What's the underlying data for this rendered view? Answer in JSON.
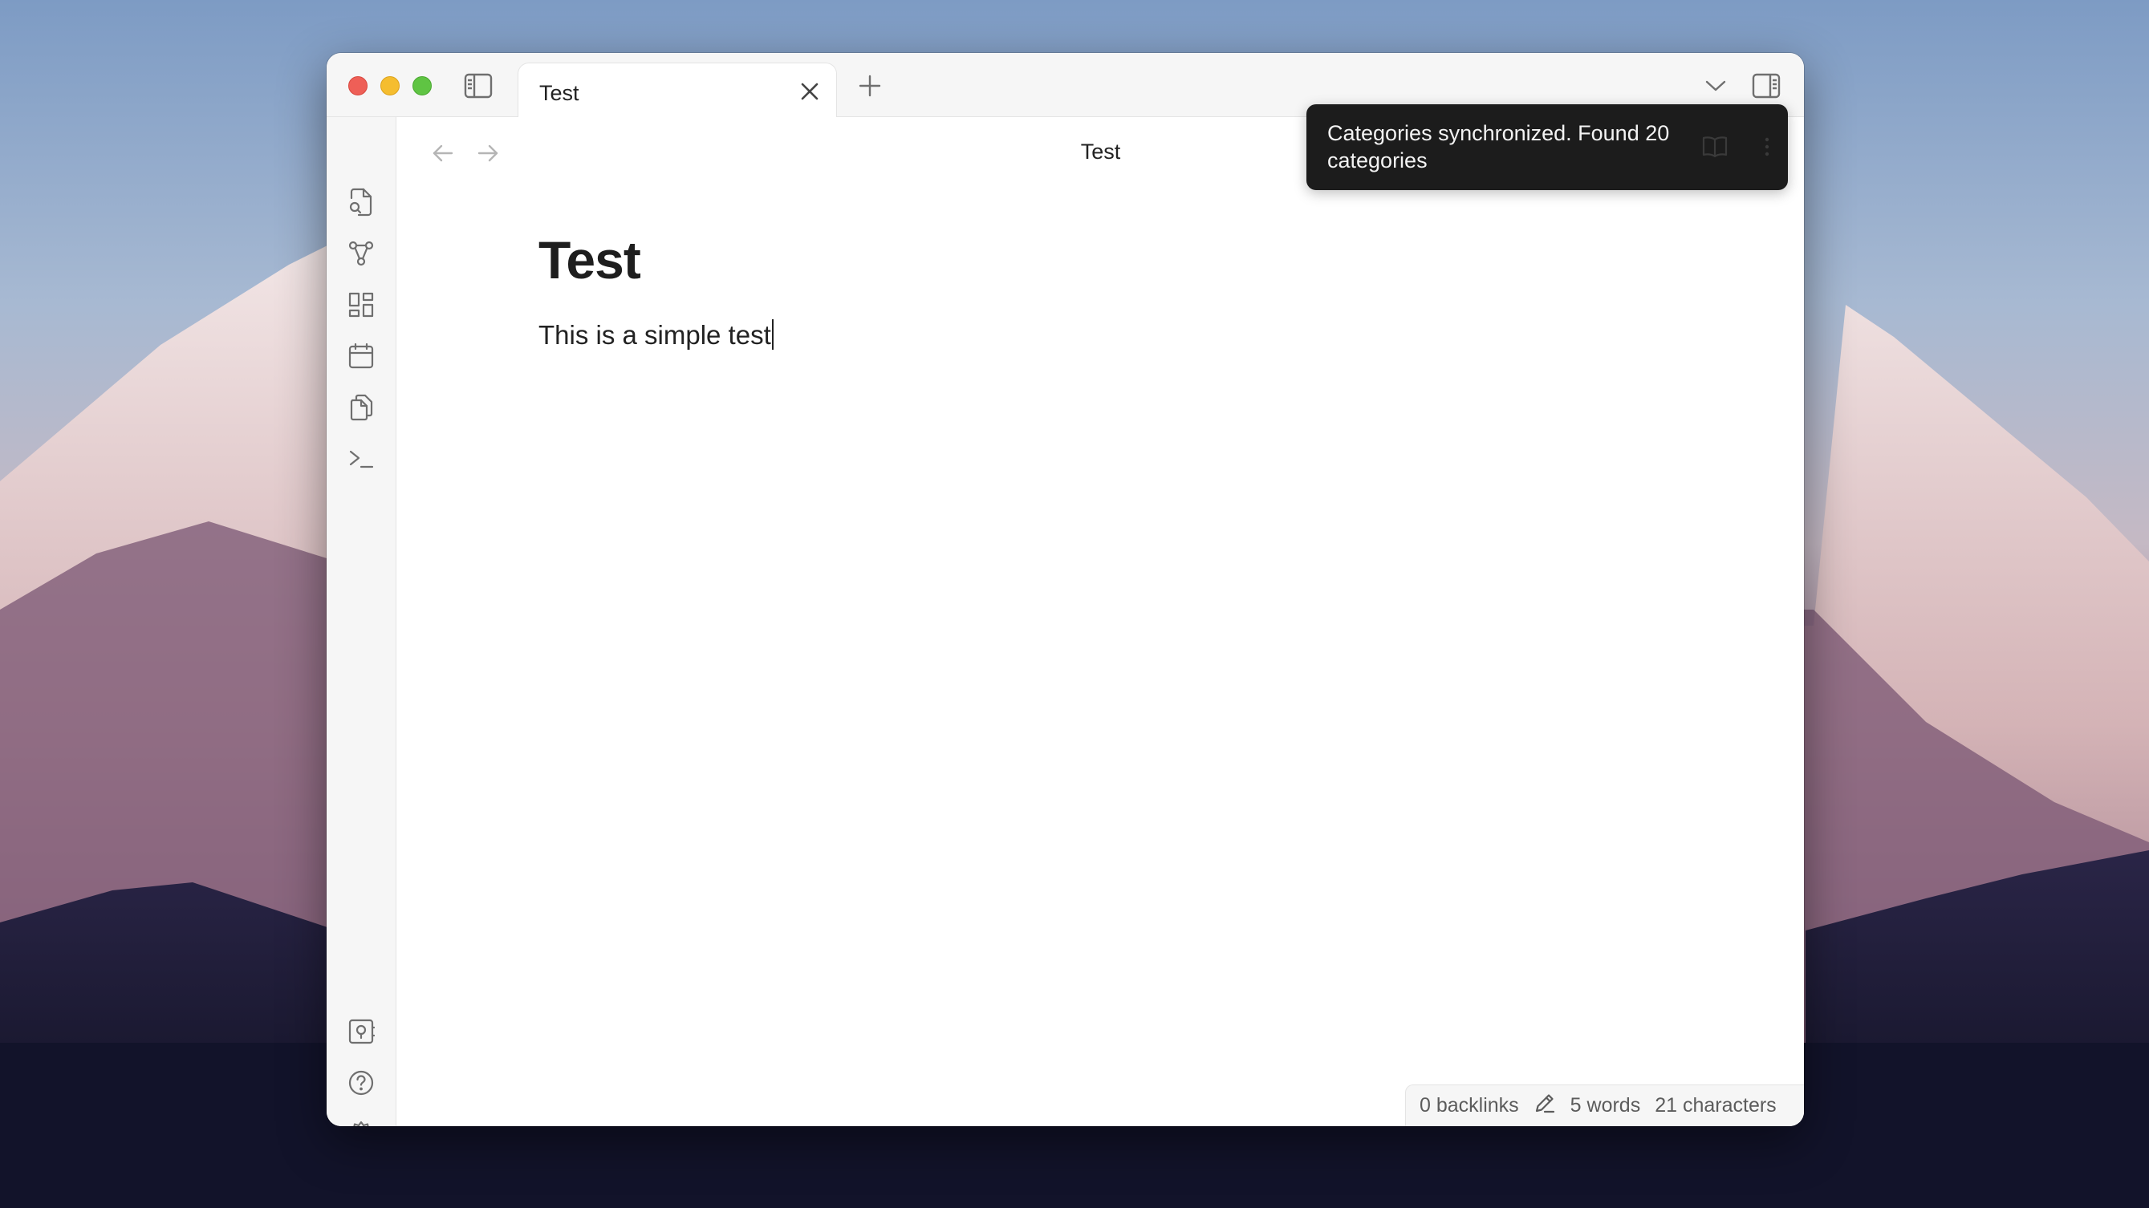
{
  "tab": {
    "title": "Test"
  },
  "view": {
    "title": "Test"
  },
  "document": {
    "heading": "Test",
    "body": "This is a simple test"
  },
  "notice": {
    "message": "Categories synchronized. Found 20 categories"
  },
  "status": {
    "backlinks": "0 backlinks",
    "words": "5 words",
    "characters": "21 characters"
  },
  "icons": {
    "ribbon_top": [
      "search-files-icon",
      "graph-icon",
      "canvas-icon",
      "calendar-icon",
      "copy-icon",
      "terminal-icon"
    ],
    "ribbon_bottom": [
      "vault-icon",
      "help-icon",
      "settings-icon"
    ]
  },
  "colors": {
    "notice_bg": "#1c1c1c",
    "window_bg": "#ffffff",
    "chrome_bg": "#f6f6f6"
  }
}
